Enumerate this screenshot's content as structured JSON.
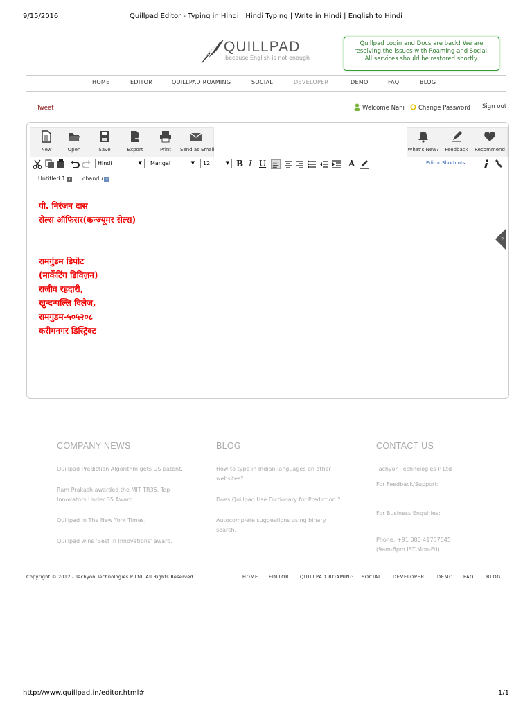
{
  "print_header": {
    "date": "9/15/2016",
    "title": "Quillpad Editor - Typing in Hindi | Hindi Typing | Write in Hindi | English to Hindi"
  },
  "logo": {
    "brand": "QUILLPAD",
    "tagline": "because English is not enough"
  },
  "notice": "Quillpad Login and Docs are back! We are resolving the issues with Roaming and Social. All services should be restored shortly.",
  "nav": [
    "HOME",
    "EDITOR",
    "QUILLPAD ROAMING",
    "SOCIAL",
    "DEVELOPER",
    "DEMO",
    "FAQ",
    "BLOG"
  ],
  "userbar": {
    "tweet": "Tweet",
    "welcome": "Welcome Nani",
    "change_password": "Change Password",
    "sign_out": "Sign out"
  },
  "toolbar": {
    "left": [
      "New",
      "Open",
      "Save",
      "Export",
      "Print",
      "Send as Email"
    ],
    "right": [
      "What's New?",
      "Feedback",
      "Recommend"
    ]
  },
  "format": {
    "language": "Hindi",
    "font": "Mangal",
    "size": "12",
    "bold": "B",
    "italic": "I",
    "underline": "U",
    "text_color": "A",
    "shortcuts": "Editor Shortcuts"
  },
  "tabs": [
    {
      "label": "Untitled 1",
      "close": "x"
    },
    {
      "label": "chandu",
      "close": "x"
    }
  ],
  "document": {
    "block1": [
      "पी. निरंजन दास",
      "सेल्स ऑफिसर(कन्ज्यूमर सेल्स)"
    ],
    "block2": [
      "रामगुंडम डिपोट",
      "(मार्केटिंग डिविज़न)",
      "राजीव रहदारी,",
      "खुन्दन्पल्लि विलेज,",
      "रामगुंडम-५०५२०८",
      "करीमनगर डिस्ट्रिक्ट"
    ]
  },
  "footer": {
    "company_news": {
      "heading": "COMPANY NEWS",
      "items": [
        "Quillpad Prediction Algorithm gets US patent.",
        "Ram Prakash awarded the MIT TR35, Top Innovators Under 35 Award.",
        "Quillpad in The New York Times.",
        "Quillpad wins 'Best in Innovations' award."
      ]
    },
    "blog": {
      "heading": "BLOG",
      "items": [
        "How to type in Indian languages on other websites?",
        "Does Quillpad Use Dictionary for Prediction ?",
        "Autocomplete suggestions using binary search."
      ]
    },
    "contact": {
      "heading": "CONTACT US",
      "company": "Tachyon Technologies P Ltd",
      "feedback": "For Feedback/Support:",
      "business": "For Business Enquiries:",
      "phone": "Phone: +91 080 41757545",
      "hours": "(9am-6pm IST Mon-Fri)"
    },
    "copyright": "Copyright © 2012 - Tachyon Technologies P Ltd. All Rights Reserved.",
    "nav": [
      "HOME",
      "EDITOR",
      "QUILLPAD ROAMING",
      "SOCIAL",
      "DEVELOPER",
      "DEMO",
      "FAQ",
      "BLOG"
    ]
  },
  "print_footer": {
    "url": "http://www.quillpad.in/editor.html#",
    "page": "1/1"
  }
}
